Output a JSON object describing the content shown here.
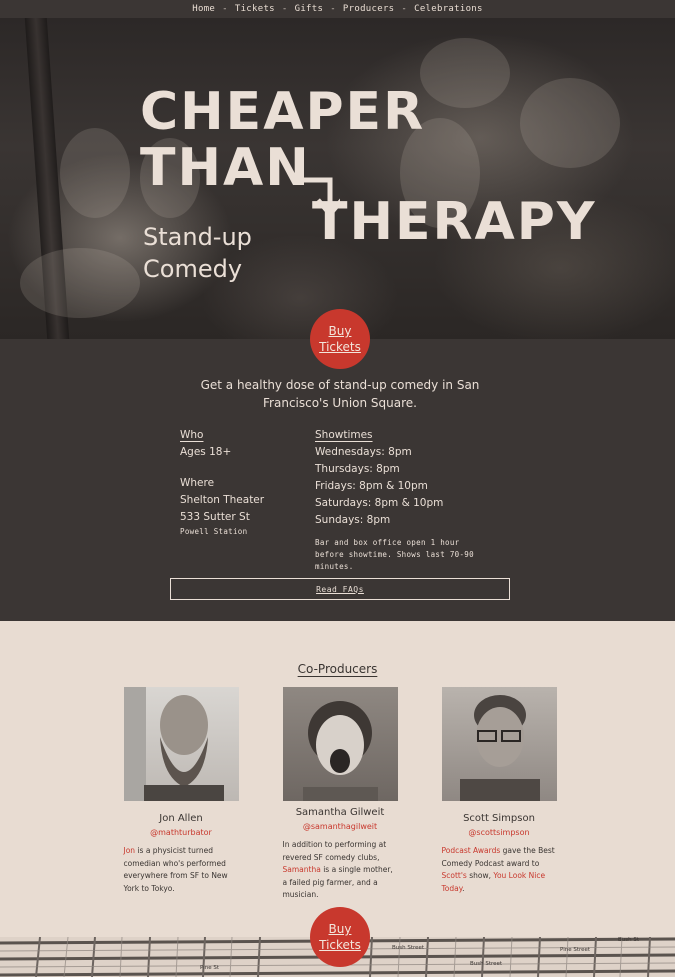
{
  "nav": {
    "items": [
      "Home",
      "Tickets",
      "Gifts",
      "Producers",
      "Celebrations"
    ],
    "separator": "-"
  },
  "hero": {
    "title_line1": "CHEAPER",
    "title_line2": "THAN",
    "title_line3": "THERAPY",
    "subtitle_line1": "Stand-up",
    "subtitle_line2": "Comedy"
  },
  "buy_button": {
    "line1": "Buy",
    "line2": "Tickets"
  },
  "info": {
    "tagline": "Get a healthy dose of stand-up comedy in San Francisco's Union Square.",
    "who_label": "Who",
    "who_value": "Ages 18+",
    "where_label": "Where",
    "venue": "Shelton Theater",
    "address": "533 Sutter St",
    "station": "Powell Station",
    "showtimes_label": "Showtimes",
    "showtimes": [
      "Wednesdays: 8pm",
      "Thursdays: 8pm",
      "Fridays: 8pm & 10pm",
      "Saturdays: 8pm & 10pm",
      "Sundays: 8pm"
    ],
    "note": "Bar and box office open 1 hour before showtime. Shows last 70-90 minutes.",
    "faq_label": "Read FAQs"
  },
  "producers": {
    "title": "Co-Producers",
    "people": [
      {
        "name": "Jon Allen",
        "handle": "@mathturbator",
        "bio_link": "Jon",
        "bio": " is a physicist turned comedian who's performed everywhere from SF to New York to Tokyo."
      },
      {
        "name": "Samantha Gilweit",
        "handle": "@samanthagilweit",
        "bio_pre": "In addition to performing at revered SF comedy clubs, ",
        "bio_link": "Samantha",
        "bio_post": " is a single mother, a failed pig farmer, and a musician."
      },
      {
        "name": "Scott Simpson",
        "handle": "@scottsimpson",
        "bio_link1": "Podcast Awards",
        "bio_mid1": " gave the Best Comedy Podcast award to ",
        "bio_link2": "Scott's",
        "bio_mid2": " show, ",
        "bio_link3": "You Look Nice Today",
        "bio_end": "."
      }
    ]
  },
  "map": {
    "labels": [
      "Pine St",
      "Bush Street",
      "Bush Street",
      "Pine Street",
      "Bush St"
    ]
  },
  "colors": {
    "dark": "#3b3634",
    "cream": "#e8dcd2",
    "accent": "#c8382d"
  }
}
